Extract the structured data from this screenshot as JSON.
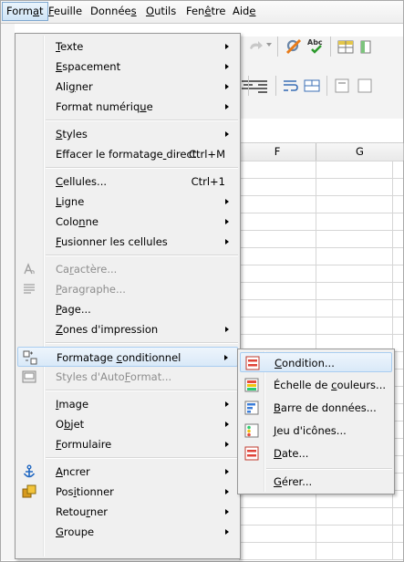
{
  "menubar": {
    "items": [
      {
        "label": "Format",
        "mnemonic_index": 4,
        "active": true
      },
      {
        "label": "Feuille",
        "mnemonic_index": 0
      },
      {
        "label": "Données",
        "mnemonic_index": 6
      },
      {
        "label": "Outils",
        "mnemonic_index": 0
      },
      {
        "label": "Fenêtre",
        "mnemonic_index": 3
      },
      {
        "label": "Aide",
        "mnemonic_index": 3
      }
    ]
  },
  "spreadsheet": {
    "columns": [
      "F",
      "G"
    ]
  },
  "format_menu": {
    "items": [
      {
        "label": "Texte",
        "u": 0,
        "submenu": true
      },
      {
        "label": "Espacement",
        "u": 0,
        "submenu": true
      },
      {
        "label": "Aligner",
        "u": 3,
        "submenu": true
      },
      {
        "label": "Format numérique",
        "u": 14,
        "submenu": true
      },
      {
        "sep": true
      },
      {
        "label": "Styles",
        "u": 0,
        "submenu": true
      },
      {
        "label": "Effacer le formatage direct",
        "u": 20,
        "accel": "Ctrl+M"
      },
      {
        "sep": true
      },
      {
        "label": "Cellules...",
        "u": 0,
        "accel": "Ctrl+1"
      },
      {
        "label": "Ligne",
        "u": 0,
        "submenu": true
      },
      {
        "label": "Colonne",
        "u": 4,
        "submenu": true
      },
      {
        "label": "Fusionner les cellules",
        "u": 0,
        "submenu": true
      },
      {
        "sep": true
      },
      {
        "label": "Caractère...",
        "u": 2,
        "disabled": true,
        "icon": "character-icon"
      },
      {
        "label": "Paragraphe...",
        "u": 0,
        "disabled": true,
        "icon": "paragraph-icon"
      },
      {
        "label": "Page...",
        "u": 0
      },
      {
        "label": "Zones d'impression",
        "u": 0,
        "submenu": true
      },
      {
        "sep": true
      },
      {
        "label": "Formatage conditionnel",
        "u": 10,
        "submenu": true,
        "highlighted": true,
        "icon": "conditional-format-icon"
      },
      {
        "label": "Styles d'AutoFormat...",
        "u": 13,
        "disabled": true,
        "icon": "autoformat-icon"
      },
      {
        "sep": true
      },
      {
        "label": "Image",
        "u": 0,
        "submenu": true
      },
      {
        "label": "Objet",
        "u": 1,
        "submenu": true
      },
      {
        "label": "Formulaire",
        "u": 0,
        "submenu": true
      },
      {
        "sep": true
      },
      {
        "label": "Ancrer",
        "u": 0,
        "submenu": true,
        "icon": "anchor-icon"
      },
      {
        "label": "Positionner",
        "u": 3,
        "submenu": true,
        "icon": "arrange-icon"
      },
      {
        "label": "Retourner",
        "u": 5,
        "submenu": true
      },
      {
        "label": "Groupe",
        "u": 0,
        "submenu": true
      }
    ]
  },
  "conditional_submenu": {
    "items": [
      {
        "label": "Condition...",
        "u": 0,
        "highlighted": true,
        "icon": "condition-icon"
      },
      {
        "label": "Échelle de couleurs...",
        "u": 11,
        "icon": "color-scale-icon"
      },
      {
        "label": "Barre de données...",
        "u": 0,
        "icon": "data-bar-icon"
      },
      {
        "label": "Jeu d'icônes...",
        "u": 0,
        "icon": "icon-set-icon"
      },
      {
        "label": "Date...",
        "u": 0,
        "icon": "date-icon"
      },
      {
        "sep": true
      },
      {
        "label": "Gérer...",
        "u": 0
      }
    ]
  },
  "colors": {
    "accent": "#a9cdf0",
    "menu_bg": "#f0f0f0"
  }
}
